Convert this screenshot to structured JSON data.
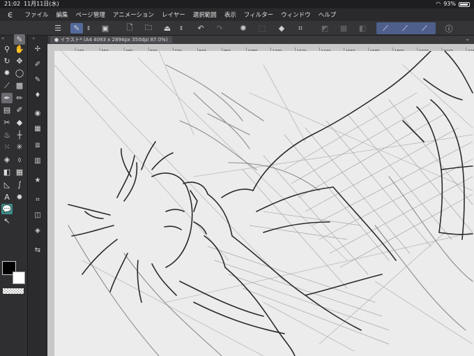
{
  "status": {
    "time": "21:02",
    "date": "11月11日(水)",
    "battery": "93%",
    "battery_level": 0.93
  },
  "menu": {
    "items": [
      "ファイル",
      "編集",
      "ページ管理",
      "アニメーション",
      "レイヤー",
      "選択範囲",
      "表示",
      "フィルター",
      "ウィンドウ",
      "ヘルプ"
    ]
  },
  "document": {
    "tab_title": "イラスト* (A4 4093 x 2894px 350dpi 87.0%)"
  },
  "ruler": {
    "h_ticks": [
      "240",
      "360",
      "480",
      "600",
      "720",
      "840",
      "960",
      "1080",
      "1200",
      "1320",
      "1440",
      "1560",
      "1680",
      "1800",
      "1920",
      "2040",
      "2160"
    ]
  },
  "colors": {
    "accent": "#546a9c",
    "main_color": "#000000",
    "sub_color": "#ffffff",
    "panel": "#2f2f32",
    "paper": "#ececec"
  },
  "icons": {
    "app_logo": "clip-studio-icon",
    "tools": [
      "pen-icon",
      "zoom-icon",
      "hand-icon",
      "rotate-icon",
      "move-icon",
      "select-icon",
      "lasso-icon",
      "eyedropper-icon",
      "autoselect-icon",
      "pen-tool-icon",
      "pencil-icon",
      "brush-icon",
      "airbrush-icon",
      "decoration-icon",
      "eraser-icon",
      "blend-icon",
      "fill-icon",
      "gradient-icon",
      "figure-icon",
      "frame-icon",
      "text-icon",
      "balloon-icon",
      "line-correction-icon"
    ]
  }
}
